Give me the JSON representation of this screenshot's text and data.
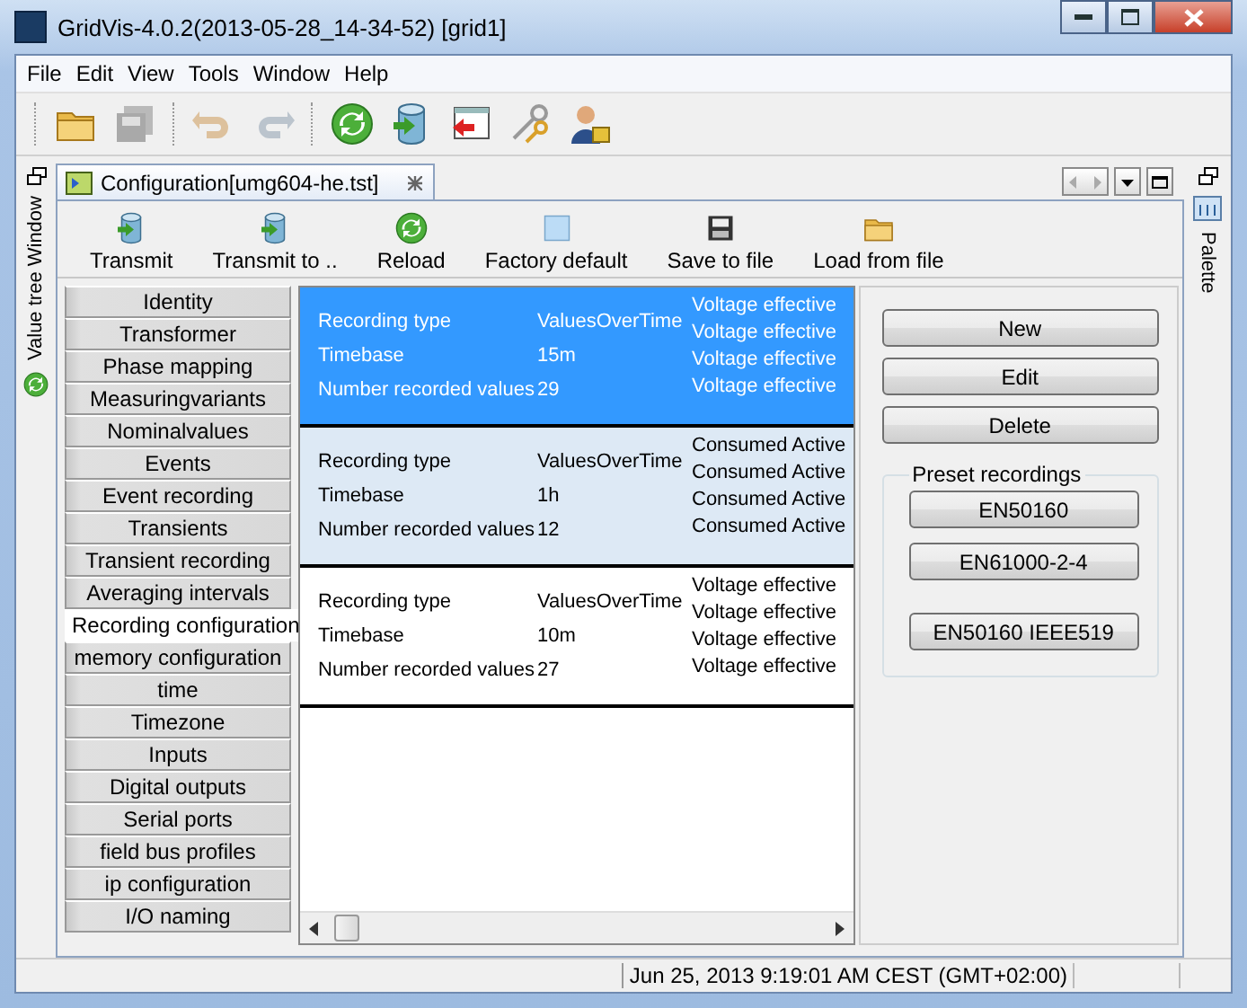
{
  "window": {
    "title": "GridVis-4.0.2(2013-05-28_14-34-52) [grid1]"
  },
  "menu": [
    "File",
    "Edit",
    "View",
    "Tools",
    "Window",
    "Help"
  ],
  "toolbar": [
    {
      "kind": "folder",
      "disabled": false
    },
    {
      "kind": "save",
      "disabled": true
    },
    {
      "kind": "undo",
      "disabled": true
    },
    {
      "kind": "redo",
      "disabled": true
    },
    {
      "kind": "reload",
      "disabled": false
    },
    {
      "kind": "database",
      "disabled": false
    },
    {
      "kind": "window",
      "disabled": false
    },
    {
      "kind": "keys",
      "disabled": false
    },
    {
      "kind": "user",
      "disabled": false
    }
  ],
  "left_dock": {
    "label": "Value tree Window"
  },
  "right_dock": {
    "label": "Palette"
  },
  "editor_tab": {
    "label": "Configuration[umg604-he.tst]"
  },
  "actions": [
    {
      "kind": "database",
      "label": "Transmit"
    },
    {
      "kind": "database",
      "label": "Transmit to .."
    },
    {
      "kind": "reload",
      "label": "Reload"
    },
    {
      "kind": "square",
      "label": "Factory default"
    },
    {
      "kind": "disk",
      "label": "Save to file"
    },
    {
      "kind": "folder",
      "label": "Load from file"
    }
  ],
  "sections": [
    {
      "label": "Identity",
      "selected": false
    },
    {
      "label": "Transformer",
      "selected": false
    },
    {
      "label": "Phase mapping",
      "selected": false
    },
    {
      "label": "Measuringvariants",
      "selected": false
    },
    {
      "label": "Nominalvalues",
      "selected": false
    },
    {
      "label": "Events",
      "selected": false
    },
    {
      "label": "Event recording",
      "selected": false
    },
    {
      "label": "Transients",
      "selected": false
    },
    {
      "label": "Transient recording",
      "selected": false
    },
    {
      "label": "Averaging intervals",
      "selected": false
    },
    {
      "label": "Recording configuration",
      "selected": true
    },
    {
      "label": "memory configuration",
      "selected": false
    },
    {
      "label": "time",
      "selected": false
    },
    {
      "label": "Timezone",
      "selected": false
    },
    {
      "label": "Inputs",
      "selected": false
    },
    {
      "label": "Digital outputs",
      "selected": false
    },
    {
      "label": "Serial ports",
      "selected": false
    },
    {
      "label": "field bus profiles",
      "selected": false
    },
    {
      "label": "ip configuration",
      "selected": false
    },
    {
      "label": "I/O naming",
      "selected": false
    }
  ],
  "recordings": [
    {
      "selected": true,
      "highlighted": false,
      "fields": [
        {
          "label": "Recording type",
          "value": "ValuesOverTime"
        },
        {
          "label": "Timebase",
          "value": "15m"
        },
        {
          "label": "Number recorded values",
          "value": "29"
        }
      ],
      "channels": [
        "Voltage effective",
        "Voltage effective",
        "Voltage effective",
        "Voltage effective"
      ]
    },
    {
      "selected": false,
      "highlighted": true,
      "fields": [
        {
          "label": "Recording type",
          "value": "ValuesOverTime"
        },
        {
          "label": "Timebase",
          "value": "1h"
        },
        {
          "label": "Number recorded values",
          "value": "12"
        }
      ],
      "channels": [
        "Consumed Active",
        "Consumed Active",
        "Consumed Active",
        "Consumed Active"
      ]
    },
    {
      "selected": false,
      "highlighted": false,
      "fields": [
        {
          "label": "Recording type",
          "value": "ValuesOverTime"
        },
        {
          "label": "Timebase",
          "value": "10m"
        },
        {
          "label": "Number recorded values",
          "value": "27"
        }
      ],
      "channels": [
        "Voltage effective",
        "Voltage effective",
        "Voltage effective",
        "Voltage effective"
      ]
    }
  ],
  "buttons": [
    "New",
    "Edit",
    "Delete"
  ],
  "presets": {
    "title": "Preset recordings",
    "buttons": [
      "EN50160",
      "EN61000-2-4",
      "EN50160 IEEE519"
    ]
  },
  "status_bar": {
    "datetime": "Jun 25, 2013 9:19:01 AM CEST (GMT+02:00)"
  }
}
